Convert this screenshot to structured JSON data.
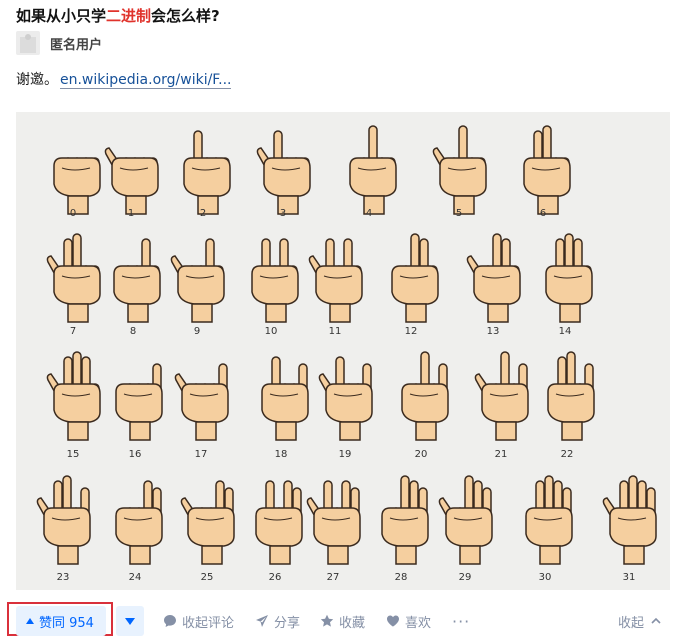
{
  "question": {
    "title_before": "如果从小只学",
    "title_highlight": "二进制",
    "title_after": "会怎么样?",
    "highlight_color": "#e0332c"
  },
  "author": {
    "name": "匿名用户"
  },
  "answer": {
    "text": "谢邀。",
    "link_text": "en.wikipedia.org/wiki/F..."
  },
  "figure": {
    "numbers": [
      "0",
      "1",
      "2",
      "3",
      "4",
      "5",
      "6",
      "7",
      "8",
      "9",
      "10",
      "11",
      "12",
      "13",
      "14",
      "15",
      "16",
      "17",
      "18",
      "19",
      "20",
      "21",
      "22",
      "23",
      "24",
      "25",
      "26",
      "27",
      "28",
      "29",
      "30",
      "31"
    ]
  },
  "actions": {
    "upvote_label": "赞同 954",
    "comments_label": "收起评论",
    "share_label": "分享",
    "favorite_label": "收藏",
    "like_label": "喜欢",
    "more_label": "···",
    "collapse_label": "收起"
  },
  "colors": {
    "accent": "#0066ff",
    "vote_bg": "#e8f2fe",
    "muted": "#8590a6",
    "highlight_box": "#d9303b"
  }
}
